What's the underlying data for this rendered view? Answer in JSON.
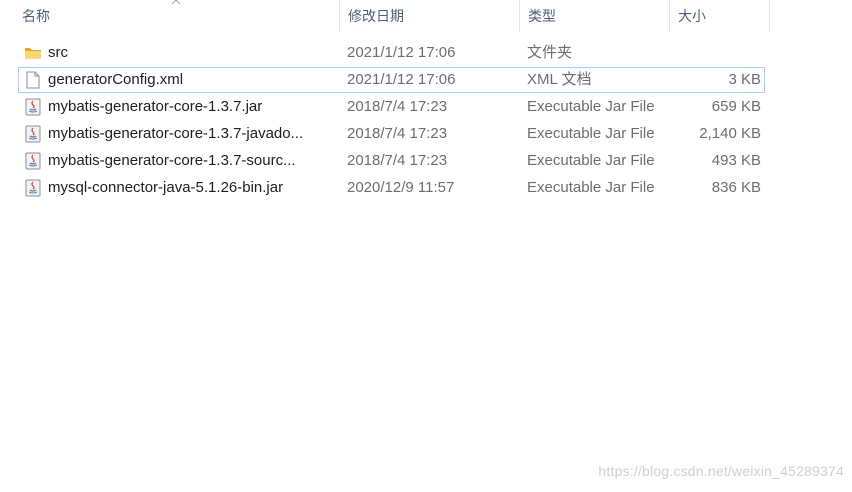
{
  "columns": {
    "name": "名称",
    "date": "修改日期",
    "type": "类型",
    "size": "大小"
  },
  "files": [
    {
      "icon": "folder-icon",
      "name": "src",
      "date": "2021/1/12 17:06",
      "type": "文件夹",
      "size": ""
    },
    {
      "icon": "xml-file-icon",
      "name": "generatorConfig.xml",
      "date": "2021/1/12 17:06",
      "type": "XML 文档",
      "size": "3 KB",
      "selected": true
    },
    {
      "icon": "jar-file-icon",
      "name": "mybatis-generator-core-1.3.7.jar",
      "date": "2018/7/4 17:23",
      "type": "Executable Jar File",
      "size": "659 KB"
    },
    {
      "icon": "jar-file-icon",
      "name": "mybatis-generator-core-1.3.7-javado...",
      "date": "2018/7/4 17:23",
      "type": "Executable Jar File",
      "size": "2,140 KB"
    },
    {
      "icon": "jar-file-icon",
      "name": "mybatis-generator-core-1.3.7-sourc...",
      "date": "2018/7/4 17:23",
      "type": "Executable Jar File",
      "size": "493 KB"
    },
    {
      "icon": "jar-file-icon",
      "name": "mysql-connector-java-5.1.26-bin.jar",
      "date": "2020/12/9 11:57",
      "type": "Executable Jar File",
      "size": "836 KB"
    }
  ],
  "sort": {
    "column": "name",
    "direction": "ascending",
    "icon": "sort-up-icon"
  },
  "colors": {
    "header_text": "#4c607a",
    "selection_border": "#99d1ff",
    "folder_yellow": "#f2c14e"
  },
  "watermark": "https://blog.csdn.net/weixin_45289374"
}
